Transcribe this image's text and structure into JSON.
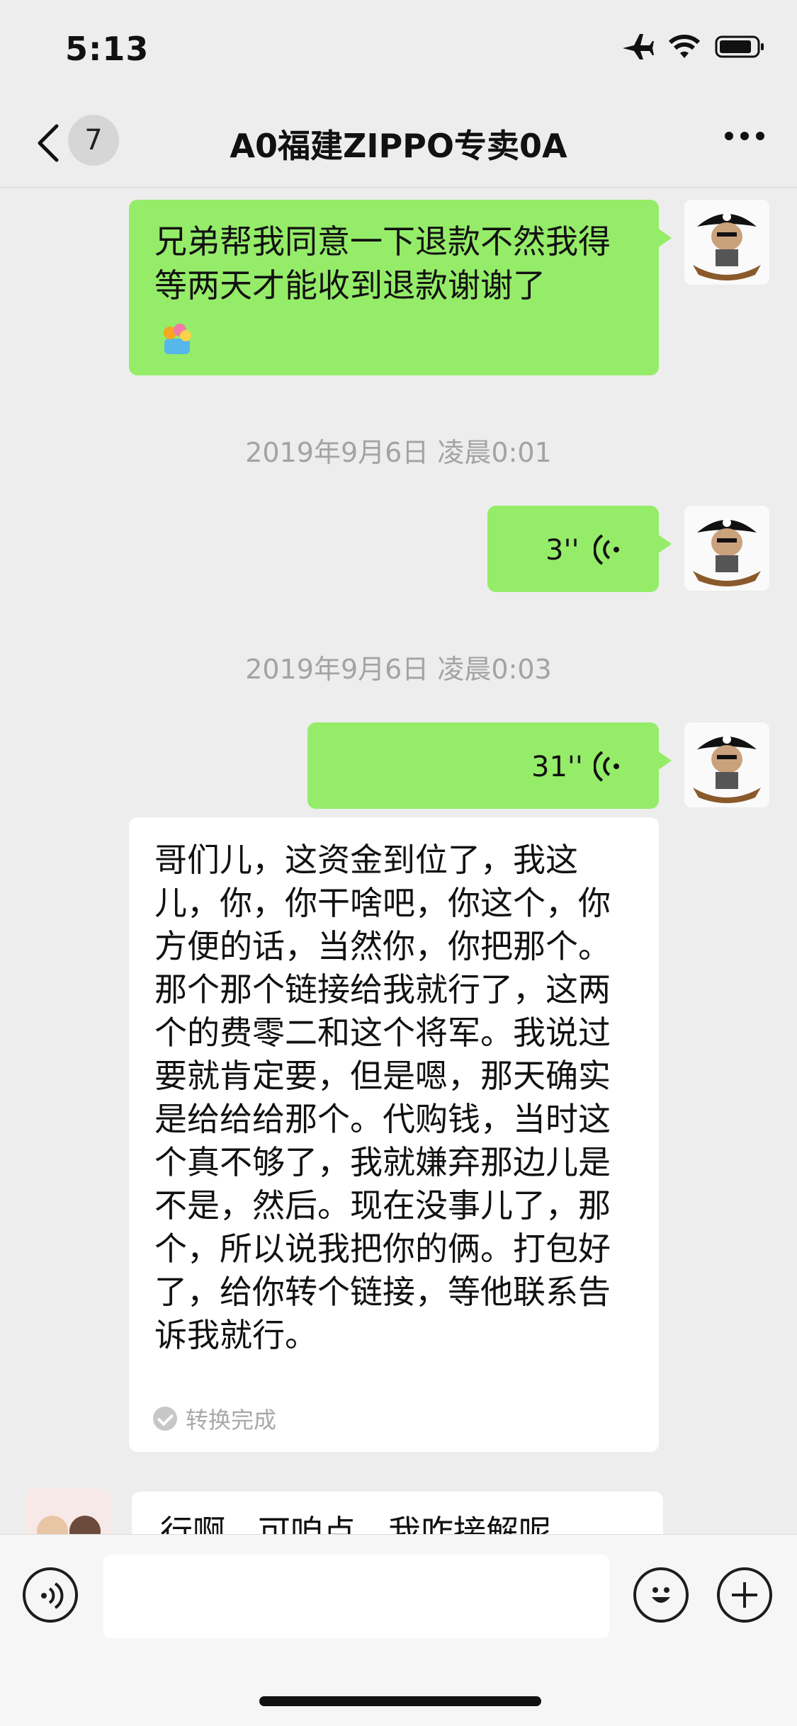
{
  "status_bar": {
    "time": "5:13"
  },
  "nav": {
    "unread_count": "7",
    "title": "A0福建ZIPPO专卖0A"
  },
  "messages": {
    "m1_text": "兄弟帮我同意一下退款不然我得等两天才能收到退款谢谢了",
    "ts1": "2019年9月6日 凌晨0:01",
    "v1_duration": "3''",
    "ts2": "2019年9月6日 凌晨0:03",
    "v2_duration": "31''",
    "transcript": "哥们儿，这资金到位了，我这儿，你，你干啥吧，你这个，你方便的话，当然你，你把那个。那个那个链接给我就行了，这两个的费零二和这个将军。我说过要就肯定要，但是嗯，那天确实是给给给那个。代购钱，当时这个真不够了，我就嫌弃那边儿是不是，然后。现在没事儿了，那个，所以说我把你的俩。打包好了，给你转个链接，等他联系告诉我就行。",
    "transcript_status": "转换完成",
    "partial_text": "行啊，可咱点，我咋接解呢"
  },
  "colors": {
    "bubble_green": "#95ec69",
    "background": "#ededed"
  },
  "icons": [
    "back-arrow-icon",
    "airplane-icon",
    "wifi-icon",
    "battery-icon",
    "more-icon",
    "voice-wave-icon",
    "sticker-emoji-icon",
    "emoji-icon",
    "plus-icon"
  ]
}
